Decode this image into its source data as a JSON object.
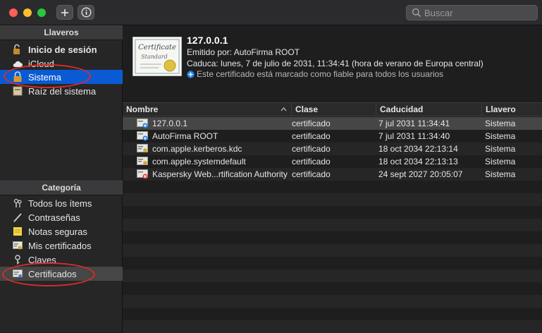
{
  "toolbar": {
    "search_placeholder": "Buscar"
  },
  "sidebar": {
    "keychains_header": "Llaveros",
    "keychains": [
      {
        "label": "Inicio de sesión"
      },
      {
        "label": "iCloud"
      },
      {
        "label": "Sistema"
      },
      {
        "label": "Raíz del sistema"
      }
    ],
    "category_header": "Categoría",
    "categories": [
      {
        "label": "Todos los ítems"
      },
      {
        "label": "Contraseñas"
      },
      {
        "label": "Notas seguras"
      },
      {
        "label": "Mis certificados"
      },
      {
        "label": "Claves"
      },
      {
        "label": "Certificados"
      }
    ]
  },
  "detail": {
    "certificate_text_1": "Certificate",
    "certificate_text_2": "Standard",
    "title": "127.0.0.1",
    "issuer": "Emitido por: AutoFirma ROOT",
    "expires": "Caduca: lunes, 7 de julio de 2031, 11:34:41 (hora de verano de Europa central)",
    "trust": "Este certificado está marcado como fiable para todos los usuarios"
  },
  "table": {
    "columns": [
      "Nombre",
      "Clase",
      "Caducidad",
      "Llavero"
    ],
    "rows": [
      {
        "name": "127.0.0.1",
        "clase": "certificado",
        "caducidad": "7 jul 2031 11:34:41",
        "llavero": "Sistema"
      },
      {
        "name": "AutoFirma ROOT",
        "clase": "certificado",
        "caducidad": "7 jul 2031 11:34:40",
        "llavero": "Sistema"
      },
      {
        "name": "com.apple.kerberos.kdc",
        "clase": "certificado",
        "caducidad": "18 oct 2034 22:13:14",
        "llavero": "Sistema"
      },
      {
        "name": "com.apple.systemdefault",
        "clase": "certificado",
        "caducidad": "18 oct 2034 22:13:13",
        "llavero": "Sistema"
      },
      {
        "name": "Kaspersky Web...rtification Authority",
        "clase": "certificado",
        "caducidad": "24 sept 2027 20:05:07",
        "llavero": "Sistema"
      }
    ]
  },
  "colors": {
    "selection_blue": "#0a5bd3",
    "annotation_red": "#d92b2b",
    "trust_icon": "#1a7ef0"
  }
}
